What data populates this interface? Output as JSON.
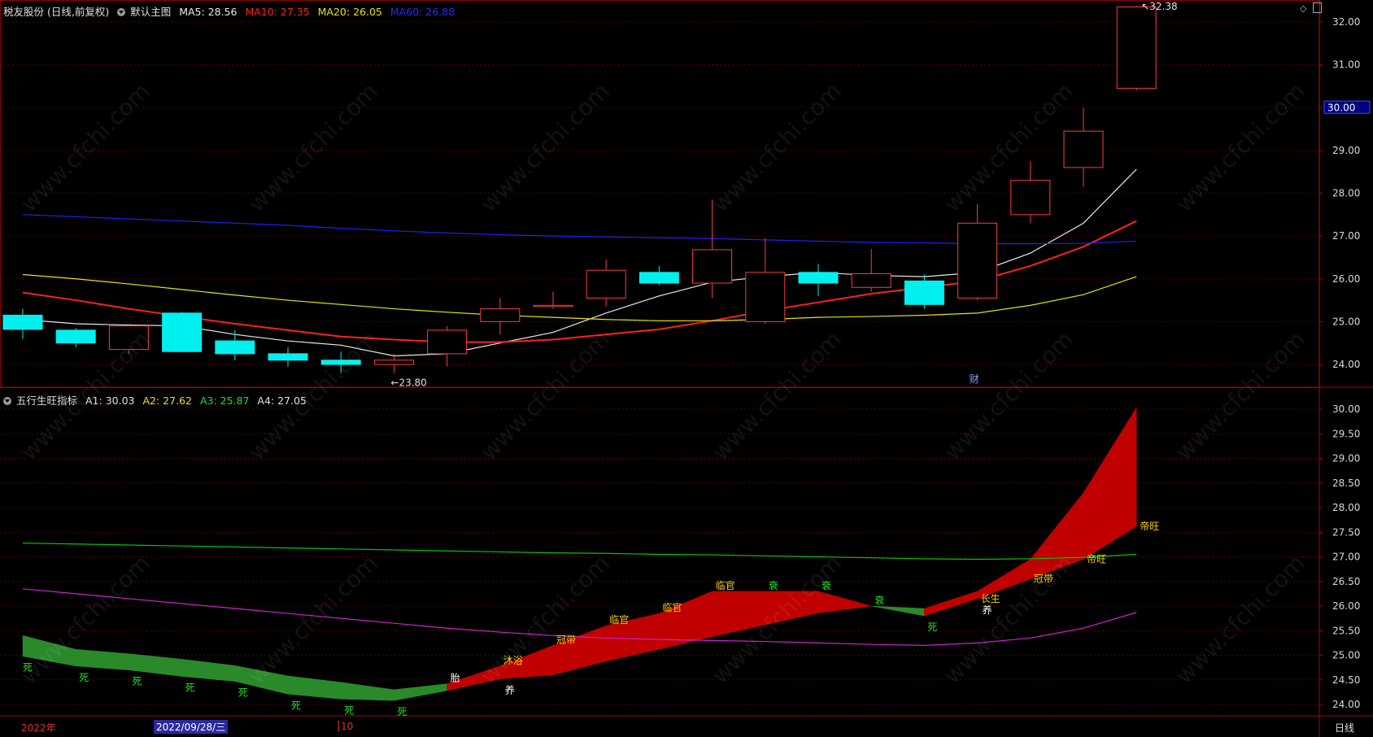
{
  "main_header": {
    "stock": "税友股份 (日线,前复权)",
    "chart_name": "默认主图",
    "ma5": "MA5: 28.56",
    "ma10": "MA10: 27.35",
    "ma20": "MA20: 26.05",
    "ma60": "MA60: 26.88"
  },
  "sub_header": {
    "name": "五行生旺指标",
    "a1": "A1: 30.03",
    "a2": "A2: 27.62",
    "a3": "A3: 25.87",
    "a4": "A4: 27.05"
  },
  "bottom_bar": {
    "year": "2022年",
    "cursor_date": "2022/09/28/三",
    "month": "10",
    "period": "日线"
  },
  "watermark": "www.cfchi.com",
  "colors": {
    "up": "#ff3b3b",
    "down": "#00f0f0",
    "ma5": "#e8e8e8",
    "ma10": "#ff2020",
    "ma20": "#e6e600",
    "ma60": "#2020ff",
    "a1": "#00c800",
    "a2": "#d020d0",
    "band_red": "#c00000",
    "band_green": "#2a8a2a",
    "grid": "#5a0000"
  },
  "chart_data": [
    {
      "type": "candlestick",
      "title": "税友股份 (日线,前复权)",
      "ylim": [
        23.6,
        32.5
      ],
      "yticks": [
        24.0,
        25.0,
        26.0,
        27.0,
        28.0,
        29.0,
        30.0,
        31.0,
        32.0
      ],
      "current_price": "30.00",
      "candles": [
        {
          "o": 25.15,
          "h": 25.3,
          "l": 24.6,
          "c": 24.82
        },
        {
          "o": 24.8,
          "h": 24.85,
          "l": 24.4,
          "c": 24.5
        },
        {
          "o": 24.35,
          "h": 24.95,
          "l": 24.25,
          "c": 24.9
        },
        {
          "o": 25.2,
          "h": 25.22,
          "l": 24.3,
          "c": 24.3
        },
        {
          "o": 24.55,
          "h": 24.8,
          "l": 24.1,
          "c": 24.25
        },
        {
          "o": 24.25,
          "h": 24.4,
          "l": 23.95,
          "c": 24.1
        },
        {
          "o": 24.1,
          "h": 24.3,
          "l": 23.8,
          "c": 24.0
        },
        {
          "o": 24.0,
          "h": 24.25,
          "l": 23.8,
          "c": 24.1
        },
        {
          "o": 24.25,
          "h": 24.9,
          "l": 23.95,
          "c": 24.8
        },
        {
          "o": 25.0,
          "h": 25.55,
          "l": 24.7,
          "c": 25.3
        },
        {
          "o": 25.35,
          "h": 25.7,
          "l": 25.3,
          "c": 25.38
        },
        {
          "o": 25.55,
          "h": 26.45,
          "l": 25.35,
          "c": 26.2
        },
        {
          "o": 26.15,
          "h": 26.3,
          "l": 25.85,
          "c": 25.9
        },
        {
          "o": 25.9,
          "h": 27.85,
          "l": 25.55,
          "c": 26.68
        },
        {
          "o": 25.0,
          "h": 26.95,
          "l": 24.95,
          "c": 26.15
        },
        {
          "o": 26.15,
          "h": 26.35,
          "l": 25.6,
          "c": 25.9
        },
        {
          "o": 25.8,
          "h": 26.7,
          "l": 25.7,
          "c": 26.12
        },
        {
          "o": 25.95,
          "h": 26.1,
          "l": 25.3,
          "c": 25.4
        },
        {
          "o": 25.55,
          "h": 27.75,
          "l": 25.5,
          "c": 27.3
        },
        {
          "o": 27.5,
          "h": 28.75,
          "l": 27.3,
          "c": 28.3
        },
        {
          "o": 28.6,
          "h": 30.0,
          "l": 28.15,
          "c": 29.45
        },
        {
          "o": 30.45,
          "h": 32.38,
          "l": 30.4,
          "c": 32.35
        }
      ],
      "high_label": "32.38",
      "low_label": "23.80",
      "event_label": "财",
      "series": [
        {
          "name": "MA5",
          "values": [
            25.05,
            24.95,
            24.92,
            24.9,
            24.7,
            24.55,
            24.45,
            24.2,
            24.25,
            24.5,
            24.75,
            25.2,
            25.6,
            25.92,
            26.05,
            26.15,
            26.08,
            26.05,
            26.15,
            26.6,
            27.3,
            28.56
          ]
        },
        {
          "name": "MA10",
          "values": [
            25.68,
            25.5,
            25.3,
            25.12,
            24.95,
            24.8,
            24.65,
            24.58,
            24.52,
            24.52,
            24.58,
            24.7,
            24.82,
            25.02,
            25.25,
            25.45,
            25.65,
            25.8,
            25.95,
            26.3,
            26.75,
            27.35
          ]
        },
        {
          "name": "MA20",
          "values": [
            26.1,
            26.0,
            25.88,
            25.75,
            25.62,
            25.5,
            25.4,
            25.3,
            25.22,
            25.15,
            25.1,
            25.05,
            25.02,
            25.02,
            25.05,
            25.1,
            25.12,
            25.15,
            25.2,
            25.38,
            25.63,
            26.05
          ]
        },
        {
          "name": "MA60",
          "values": [
            27.5,
            27.45,
            27.4,
            27.35,
            27.3,
            27.25,
            27.18,
            27.12,
            27.07,
            27.03,
            27.0,
            26.98,
            26.96,
            26.94,
            26.91,
            26.88,
            26.85,
            26.84,
            26.82,
            26.82,
            26.83,
            26.88
          ]
        }
      ]
    },
    {
      "type": "area",
      "title": "五行生旺指标",
      "ylim": [
        23.8,
        30.2
      ],
      "yticks": [
        24.0,
        24.5,
        25.0,
        25.5,
        26.0,
        26.5,
        27.0,
        27.5,
        28.0,
        28.5,
        29.0,
        29.5,
        30.0
      ],
      "band_upper": [
        25.4,
        25.12,
        25.03,
        24.92,
        24.79,
        24.58,
        24.45,
        24.3,
        24.42,
        24.78,
        25.2,
        25.6,
        25.85,
        26.3,
        26.3,
        26.3,
        26.0,
        25.95,
        26.3,
        26.95,
        28.3,
        30.03
      ],
      "band_lower": [
        24.98,
        24.78,
        24.7,
        24.57,
        24.47,
        24.21,
        24.11,
        24.08,
        24.28,
        24.52,
        24.6,
        24.88,
        25.12,
        25.38,
        25.62,
        25.86,
        26.0,
        25.8,
        26.15,
        26.55,
        26.95,
        27.62
      ],
      "labels": [
        "死",
        "死",
        "死",
        "死",
        "死",
        "死",
        "死",
        "死",
        "胎",
        "沐浴",
        "冠带",
        "临官",
        "临官",
        "临官",
        "衰",
        "衰",
        "衰",
        "死",
        "长生",
        "冠带",
        "帝旺",
        "帝旺"
      ],
      "labels2": [
        "",
        "",
        "",
        "",
        "",
        "",
        "",
        "",
        "",
        "养",
        "",
        "",
        "",
        "",
        "",
        "",
        "",
        "",
        "养",
        "",
        "",
        ""
      ],
      "series": [
        {
          "name": "A1",
          "values": [
            27.28,
            27.26,
            27.24,
            27.22,
            27.2,
            27.18,
            27.16,
            27.14,
            27.12,
            27.1,
            27.08,
            27.07,
            27.05,
            27.04,
            27.02,
            27.0,
            26.98,
            26.96,
            26.95,
            26.96,
            26.99,
            27.05
          ]
        },
        {
          "name": "A2",
          "values": [
            26.35,
            26.25,
            26.15,
            26.05,
            25.95,
            25.85,
            25.75,
            25.65,
            25.55,
            25.47,
            25.4,
            25.35,
            25.32,
            25.3,
            25.28,
            25.25,
            25.22,
            25.2,
            25.25,
            25.35,
            25.55,
            25.87
          ]
        }
      ]
    }
  ]
}
